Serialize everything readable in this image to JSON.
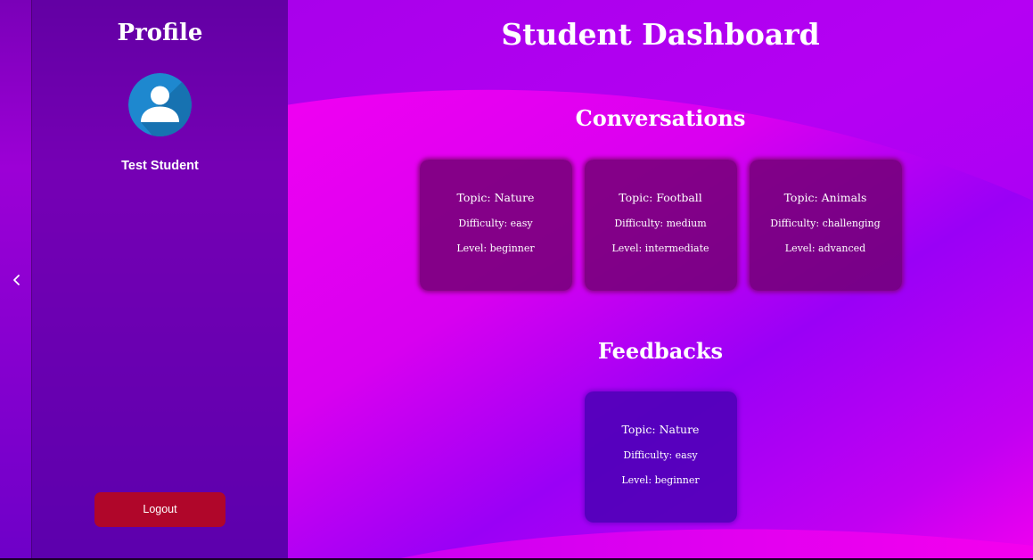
{
  "sidebar": {
    "title": "Profile",
    "user_name": "Test Student",
    "logout_label": "Logout",
    "collapse_icon": "chevron-left-icon",
    "avatar_icon": "user-avatar-icon"
  },
  "main": {
    "title": "Student Dashboard",
    "conversations": {
      "title": "Conversations",
      "items": [
        {
          "topic": "Topic: Nature",
          "difficulty": "Difficulty: easy",
          "level": "Level: beginner"
        },
        {
          "topic": "Topic: Football",
          "difficulty": "Difficulty: medium",
          "level": "Level: intermediate"
        },
        {
          "topic": "Topic: Animals",
          "difficulty": "Difficulty: challenging",
          "level": "Level: advanced"
        }
      ]
    },
    "feedbacks": {
      "title": "Feedbacks",
      "items": [
        {
          "topic": "Topic: Nature",
          "difficulty": "Difficulty: easy",
          "level": "Level: beginner"
        }
      ]
    }
  },
  "colors": {
    "background_purple": "#9a00f0",
    "background_magenta": "#f600f2",
    "logout_button": "#b0062a",
    "conversation_card": "#700070",
    "feedback_card": "#4a00b4",
    "avatar_blue": "#1e88cf"
  }
}
